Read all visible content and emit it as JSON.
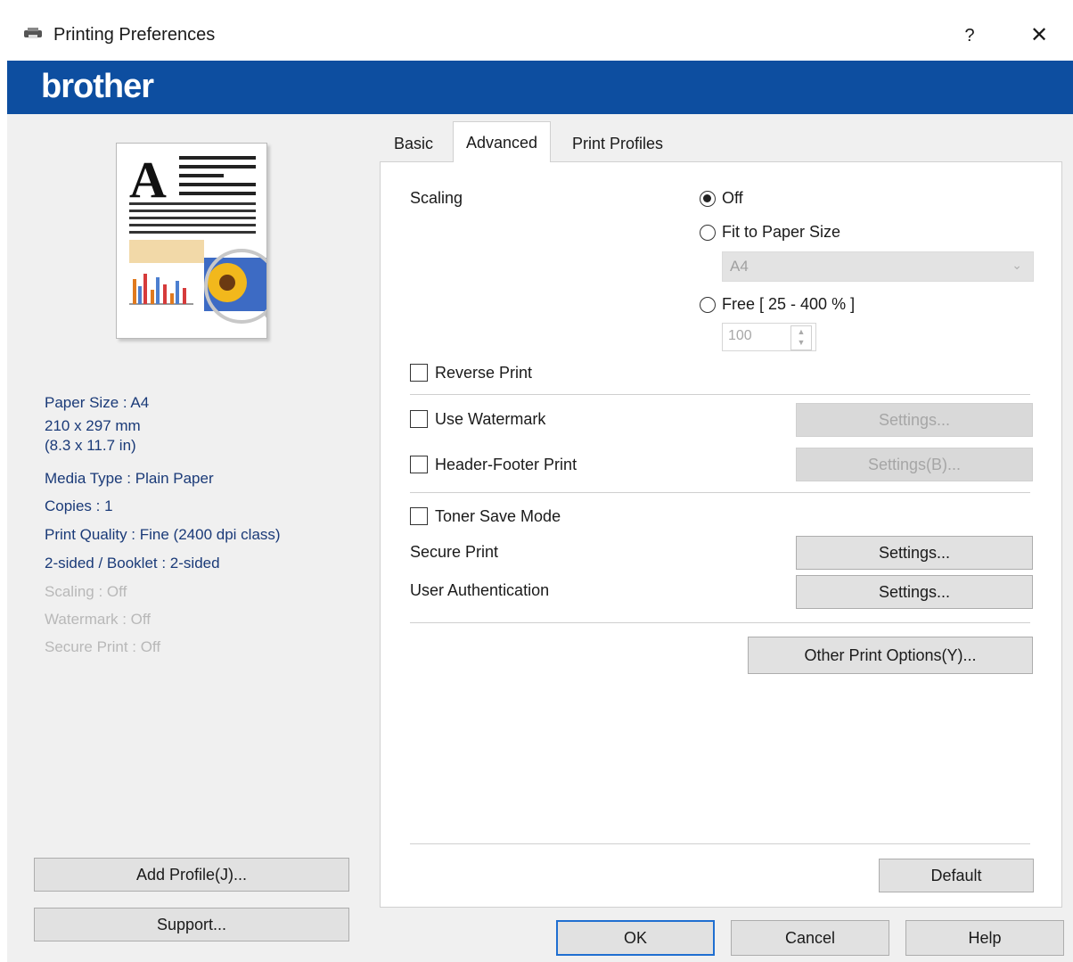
{
  "window": {
    "title": "Printing Preferences",
    "help": "?",
    "close": "✕",
    "brand": "brother"
  },
  "summary": {
    "paper_size": "Paper Size : A4",
    "paper_mm": "210 x 297 mm",
    "paper_in": "(8.3 x 11.7 in)",
    "media_type": "Media Type : Plain Paper",
    "copies": "Copies : 1",
    "print_quality": "Print Quality : Fine (2400 dpi class)",
    "two_sided": "2-sided / Booklet : 2-sided",
    "scaling": "Scaling : Off",
    "watermark": "Watermark : Off",
    "secure_print": "Secure Print : Off"
  },
  "left_buttons": {
    "add_profile": "Add Profile(J)...",
    "support": "Support..."
  },
  "tabs": [
    {
      "label": "Basic",
      "active": false
    },
    {
      "label": "Advanced",
      "active": true
    },
    {
      "label": "Print Profiles",
      "active": false
    }
  ],
  "advanced": {
    "scaling_label": "Scaling",
    "scaling_options": [
      {
        "label": "Off",
        "selected": true
      },
      {
        "label": "Fit to Paper Size",
        "selected": false
      },
      {
        "label": "Free [ 25 - 400 % ]",
        "selected": false
      }
    ],
    "paper_size_value": "A4",
    "free_value": "100",
    "reverse_print": "Reverse Print",
    "use_watermark": "Use Watermark",
    "header_footer": "Header-Footer Print",
    "toner_save": "Toner Save Mode",
    "secure_print": "Secure Print",
    "user_auth": "User Authentication",
    "settings_label": "Settings...",
    "settings_b_label": "Settings(B)...",
    "other_options": "Other Print Options(Y)...",
    "default": "Default"
  },
  "dialog_buttons": {
    "ok": "OK",
    "cancel": "Cancel",
    "help": "Help"
  },
  "colors": {
    "brand_bar": "#0d4ea0",
    "summary_text": "#1a3a78",
    "ok_border": "#1f6fd1"
  }
}
